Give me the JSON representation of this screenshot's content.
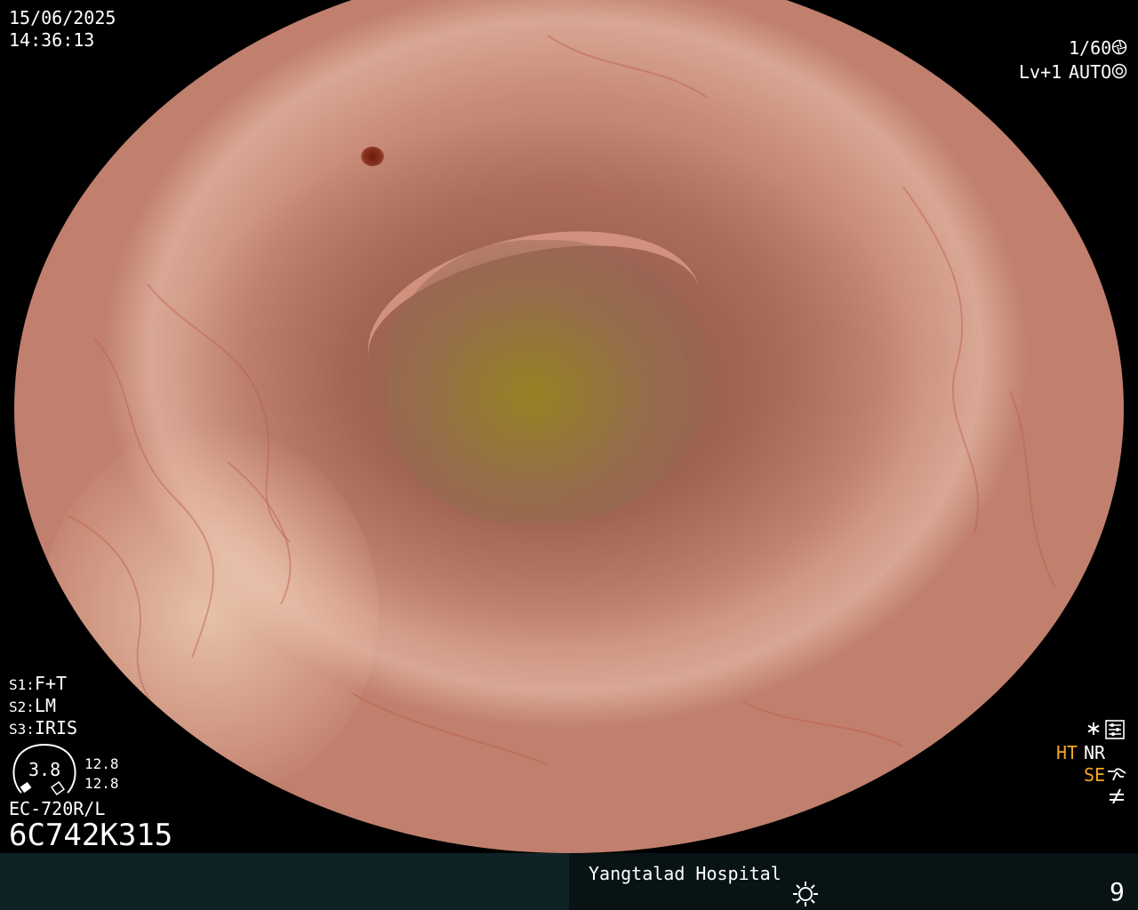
{
  "overlay": {
    "date": "15/06/2025",
    "time": "14:36:13",
    "shutter": "1/60",
    "level": "Lv+1",
    "mode": "AUTO",
    "settings": [
      {
        "key": "S1:",
        "value": "F+T"
      },
      {
        "key": "S2:",
        "value": "LM"
      },
      {
        "key": "S3:",
        "value": "IRIS"
      }
    ],
    "gauge": {
      "value": "3.8",
      "top": "12.8",
      "bottom": "12.8"
    },
    "scope_model": "EC-720R/L",
    "serial": "6C742K315",
    "right_flags": {
      "ht": "HT",
      "nr": "NR",
      "se": "SE"
    },
    "hospital": "Yangtalad Hospital",
    "page_number": "9"
  },
  "icons": [
    "aperture-icon",
    "iris-icon",
    "asterisk-icon",
    "settings-icon",
    "brightness-icon",
    "not-equal-icon",
    "enhance-icon"
  ],
  "colors": {
    "accent": "#f5a623",
    "footer_left": "#0f2326",
    "footer_right": "#071315",
    "tissue": "#c88b78"
  }
}
